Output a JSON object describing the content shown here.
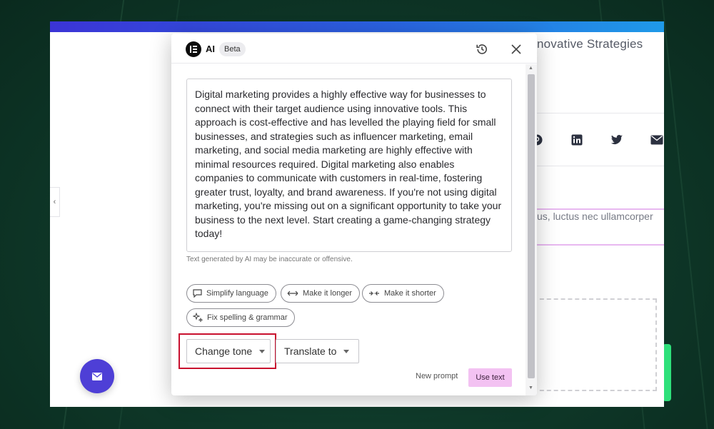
{
  "page": {
    "article_title": "novative Strategies",
    "body_snippet": "us, luctus nec ullamcorper",
    "colors": {
      "accent": "#4e3fd6",
      "highlight": "#c8102e",
      "use_text_bg": "#f3c2f2"
    }
  },
  "social": [
    "pinterest-icon",
    "linkedin-icon",
    "twitter-icon",
    "email-icon"
  ],
  "modal": {
    "brand": "AI",
    "badge": "Beta",
    "result_text": "Digital marketing provides a highly effective way for businesses to connect with their target audience using innovative tools. This approach is cost-effective and has levelled the playing field for small businesses, and strategies such as influencer marketing, email marketing, and social media marketing are highly effective with minimal resources required. Digital marketing also enables companies to communicate with customers in real-time, fostering greater trust, loyalty, and brand awareness. If you're not using digital marketing, you're missing out on a significant opportunity to take your business to the next level. Start creating a game-changing strategy today!",
    "disclaimer": "Text generated by AI may be inaccurate or offensive.",
    "chips": {
      "simplify": "Simplify language",
      "longer": "Make it longer",
      "shorter": "Make it shorter",
      "fix": "Fix spelling & grammar"
    },
    "dropdowns": {
      "tone": "Change tone",
      "translate": "Translate to"
    },
    "new_prompt": "New prompt",
    "use_text": "Use text"
  }
}
